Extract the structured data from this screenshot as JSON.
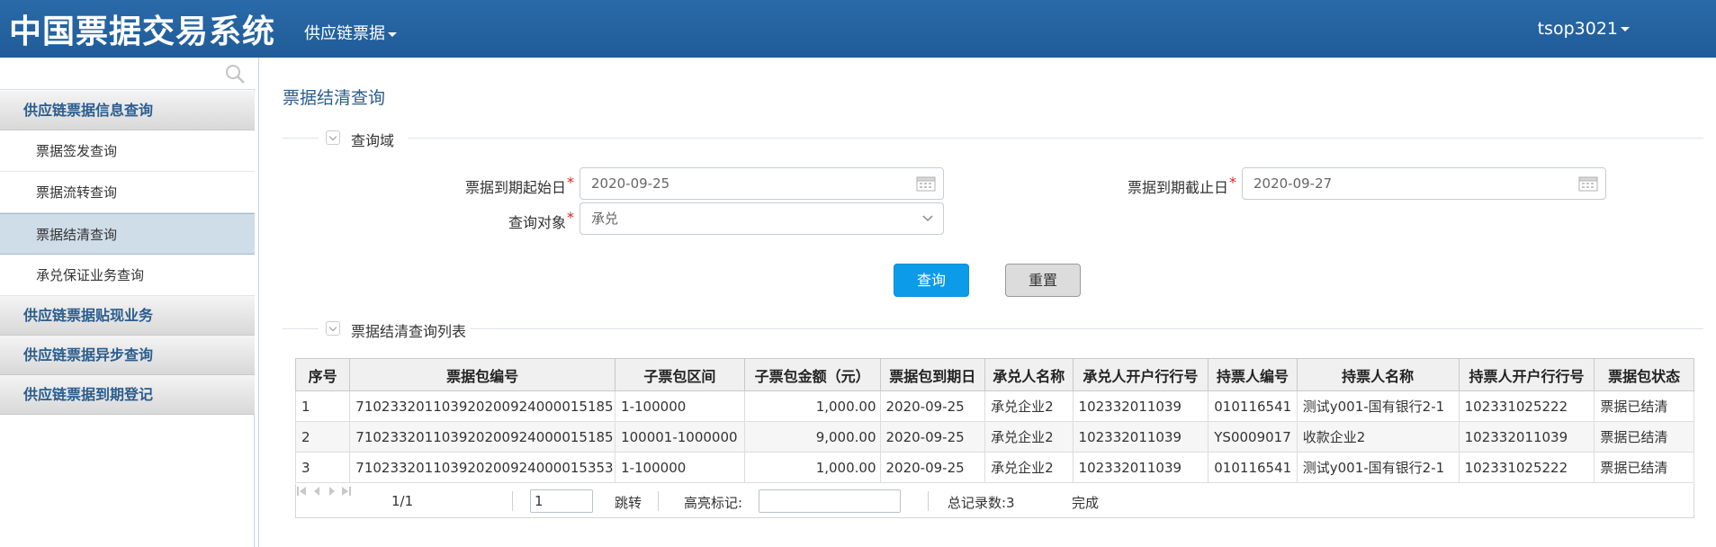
{
  "header": {
    "app_title": "中国票据交易系统",
    "menu_label": "供应链票据",
    "user_label": "tsop3021"
  },
  "sidebar": {
    "search_placeholder": "",
    "groups": [
      {
        "label": "供应链票据信息查询"
      },
      {
        "label": "供应链票据贴现业务"
      },
      {
        "label": "供应链票据异步查询"
      },
      {
        "label": "供应链票据到期登记"
      }
    ],
    "items": [
      {
        "label": "票据签发查询"
      },
      {
        "label": "票据流转查询"
      },
      {
        "label": "票据结清查询"
      },
      {
        "label": "承兑保证业务查询"
      }
    ],
    "active_item": "票据结清查询"
  },
  "page": {
    "title": "票据结清查询",
    "query_section": "查询域",
    "list_section": "票据结清查询列表"
  },
  "form": {
    "start_date_label": "票据到期起始日",
    "start_date_value": "2020-09-25",
    "end_date_label": "票据到期截止日",
    "end_date_value": "2020-09-27",
    "target_label": "查询对象",
    "target_value": "承兑",
    "required_mark": "*"
  },
  "buttons": {
    "query": "查询",
    "reset": "重置"
  },
  "table": {
    "columns": [
      "序号",
      "票据包编号",
      "子票包区间",
      "子票包金额（元）",
      "票据包到期日",
      "承兑人名称",
      "承兑人开户行行号",
      "持票人编号",
      "持票人名称",
      "持票人开户行行号",
      "票据包状态"
    ],
    "rows": [
      [
        "1",
        "710233201103920200924000015185",
        "1-100000",
        "1,000.00",
        "2020-09-25",
        "承兑企业2",
        "102332011039",
        "010116541",
        "测试y001-国有银行2-1",
        "102331025222",
        "票据已结清"
      ],
      [
        "2",
        "710233201103920200924000015185",
        "100001-1000000",
        "9,000.00",
        "2020-09-25",
        "承兑企业2",
        "102332011039",
        "YS0009017",
        "收款企业2",
        "102332011039",
        "票据已结清"
      ],
      [
        "3",
        "710233201103920200924000015353",
        "1-100000",
        "1,000.00",
        "2020-09-25",
        "承兑企业2",
        "102332011039",
        "010116541",
        "测试y001-国有银行2-1",
        "102331025222",
        "票据已结清"
      ]
    ]
  },
  "pager": {
    "page_info": "1/1",
    "page_input": "1",
    "jump_label": "跳转",
    "highlight_label": "高亮标记:",
    "highlight_value": "",
    "total_label": "总记录数:3",
    "status": "完成"
  },
  "colors": {
    "header_bg": "#2a6aa8",
    "link_blue": "#2a5d8f",
    "primary_button": "#0c9be8",
    "required": "#e02020"
  }
}
